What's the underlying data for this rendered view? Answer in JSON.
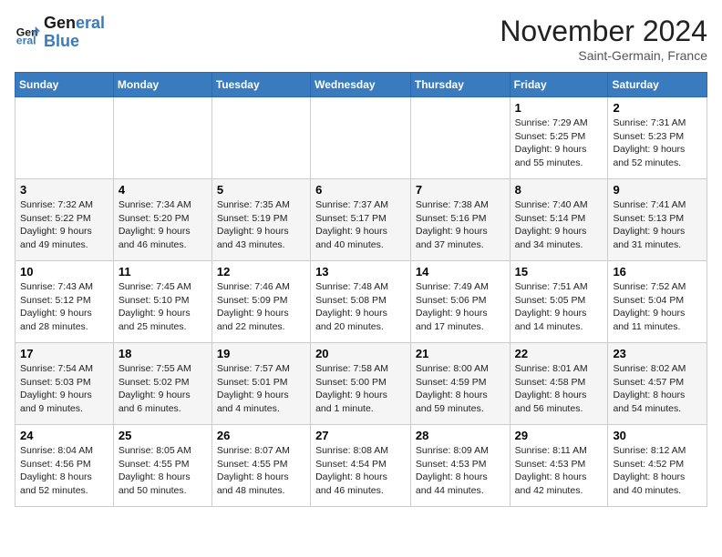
{
  "header": {
    "logo_line1": "General",
    "logo_line2": "Blue",
    "month_title": "November 2024",
    "location": "Saint-Germain, France"
  },
  "weekdays": [
    "Sunday",
    "Monday",
    "Tuesday",
    "Wednesday",
    "Thursday",
    "Friday",
    "Saturday"
  ],
  "weeks": [
    [
      {
        "day": "",
        "info": ""
      },
      {
        "day": "",
        "info": ""
      },
      {
        "day": "",
        "info": ""
      },
      {
        "day": "",
        "info": ""
      },
      {
        "day": "",
        "info": ""
      },
      {
        "day": "1",
        "info": "Sunrise: 7:29 AM\nSunset: 5:25 PM\nDaylight: 9 hours and 55 minutes."
      },
      {
        "day": "2",
        "info": "Sunrise: 7:31 AM\nSunset: 5:23 PM\nDaylight: 9 hours and 52 minutes."
      }
    ],
    [
      {
        "day": "3",
        "info": "Sunrise: 7:32 AM\nSunset: 5:22 PM\nDaylight: 9 hours and 49 minutes."
      },
      {
        "day": "4",
        "info": "Sunrise: 7:34 AM\nSunset: 5:20 PM\nDaylight: 9 hours and 46 minutes."
      },
      {
        "day": "5",
        "info": "Sunrise: 7:35 AM\nSunset: 5:19 PM\nDaylight: 9 hours and 43 minutes."
      },
      {
        "day": "6",
        "info": "Sunrise: 7:37 AM\nSunset: 5:17 PM\nDaylight: 9 hours and 40 minutes."
      },
      {
        "day": "7",
        "info": "Sunrise: 7:38 AM\nSunset: 5:16 PM\nDaylight: 9 hours and 37 minutes."
      },
      {
        "day": "8",
        "info": "Sunrise: 7:40 AM\nSunset: 5:14 PM\nDaylight: 9 hours and 34 minutes."
      },
      {
        "day": "9",
        "info": "Sunrise: 7:41 AM\nSunset: 5:13 PM\nDaylight: 9 hours and 31 minutes."
      }
    ],
    [
      {
        "day": "10",
        "info": "Sunrise: 7:43 AM\nSunset: 5:12 PM\nDaylight: 9 hours and 28 minutes."
      },
      {
        "day": "11",
        "info": "Sunrise: 7:45 AM\nSunset: 5:10 PM\nDaylight: 9 hours and 25 minutes."
      },
      {
        "day": "12",
        "info": "Sunrise: 7:46 AM\nSunset: 5:09 PM\nDaylight: 9 hours and 22 minutes."
      },
      {
        "day": "13",
        "info": "Sunrise: 7:48 AM\nSunset: 5:08 PM\nDaylight: 9 hours and 20 minutes."
      },
      {
        "day": "14",
        "info": "Sunrise: 7:49 AM\nSunset: 5:06 PM\nDaylight: 9 hours and 17 minutes."
      },
      {
        "day": "15",
        "info": "Sunrise: 7:51 AM\nSunset: 5:05 PM\nDaylight: 9 hours and 14 minutes."
      },
      {
        "day": "16",
        "info": "Sunrise: 7:52 AM\nSunset: 5:04 PM\nDaylight: 9 hours and 11 minutes."
      }
    ],
    [
      {
        "day": "17",
        "info": "Sunrise: 7:54 AM\nSunset: 5:03 PM\nDaylight: 9 hours and 9 minutes."
      },
      {
        "day": "18",
        "info": "Sunrise: 7:55 AM\nSunset: 5:02 PM\nDaylight: 9 hours and 6 minutes."
      },
      {
        "day": "19",
        "info": "Sunrise: 7:57 AM\nSunset: 5:01 PM\nDaylight: 9 hours and 4 minutes."
      },
      {
        "day": "20",
        "info": "Sunrise: 7:58 AM\nSunset: 5:00 PM\nDaylight: 9 hours and 1 minute."
      },
      {
        "day": "21",
        "info": "Sunrise: 8:00 AM\nSunset: 4:59 PM\nDaylight: 8 hours and 59 minutes."
      },
      {
        "day": "22",
        "info": "Sunrise: 8:01 AM\nSunset: 4:58 PM\nDaylight: 8 hours and 56 minutes."
      },
      {
        "day": "23",
        "info": "Sunrise: 8:02 AM\nSunset: 4:57 PM\nDaylight: 8 hours and 54 minutes."
      }
    ],
    [
      {
        "day": "24",
        "info": "Sunrise: 8:04 AM\nSunset: 4:56 PM\nDaylight: 8 hours and 52 minutes."
      },
      {
        "day": "25",
        "info": "Sunrise: 8:05 AM\nSunset: 4:55 PM\nDaylight: 8 hours and 50 minutes."
      },
      {
        "day": "26",
        "info": "Sunrise: 8:07 AM\nSunset: 4:55 PM\nDaylight: 8 hours and 48 minutes."
      },
      {
        "day": "27",
        "info": "Sunrise: 8:08 AM\nSunset: 4:54 PM\nDaylight: 8 hours and 46 minutes."
      },
      {
        "day": "28",
        "info": "Sunrise: 8:09 AM\nSunset: 4:53 PM\nDaylight: 8 hours and 44 minutes."
      },
      {
        "day": "29",
        "info": "Sunrise: 8:11 AM\nSunset: 4:53 PM\nDaylight: 8 hours and 42 minutes."
      },
      {
        "day": "30",
        "info": "Sunrise: 8:12 AM\nSunset: 4:52 PM\nDaylight: 8 hours and 40 minutes."
      }
    ]
  ]
}
